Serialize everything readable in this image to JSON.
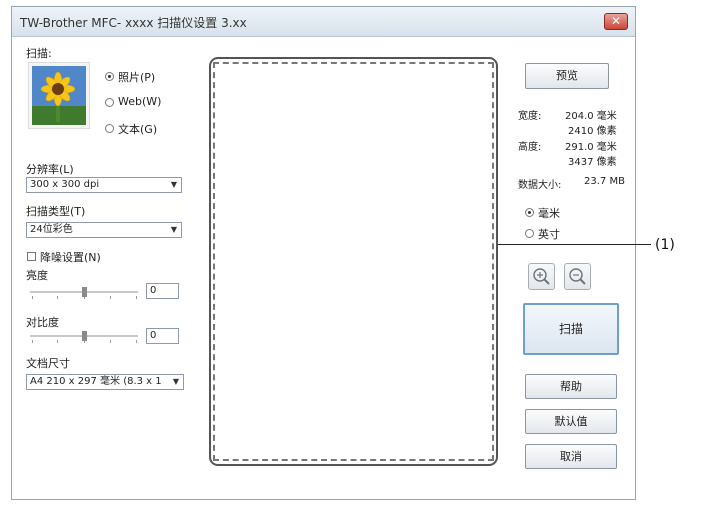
{
  "window": {
    "title": "TW-Brother MFC- xxxx 扫描仪设置 3.xx",
    "close_glyph": "✕"
  },
  "scan": {
    "label": "扫描:",
    "options": [
      {
        "label": "照片(P)",
        "selected": true
      },
      {
        "label": "Web(W)",
        "selected": false
      },
      {
        "label": "文本(G)",
        "selected": false
      }
    ]
  },
  "resolution": {
    "label": "分辨率(L)",
    "value": "300 x 300 dpi"
  },
  "scan_type": {
    "label": "扫描类型(T)",
    "value": "24位彩色"
  },
  "noise_reduction": {
    "label": "降噪设置(N)",
    "checked": false
  },
  "brightness": {
    "label": "亮度",
    "value": "0"
  },
  "contrast": {
    "label": "对比度",
    "value": "0"
  },
  "doc_size": {
    "label": "文档尺寸",
    "value": "A4 210 x 297 毫米 (8.3 x 1"
  },
  "preview_button": "预览",
  "dimensions": {
    "width_label": "宽度:",
    "width_mm": "204.0 毫米",
    "width_px": "2410 像素",
    "height_label": "高度:",
    "height_mm": "291.0 毫米",
    "height_px": "3437 像素",
    "size_label": "数据大小:",
    "size_value": "23.7 MB"
  },
  "units": [
    {
      "label": "毫米",
      "selected": true
    },
    {
      "label": "英寸",
      "selected": false
    }
  ],
  "zoom_in_icon": "zoom-in-icon",
  "zoom_out_icon": "zoom-out-icon",
  "scan_button": "扫描",
  "help_button": "帮助",
  "default_button": "默认值",
  "cancel_button": "取消",
  "callout_label": "(1)"
}
